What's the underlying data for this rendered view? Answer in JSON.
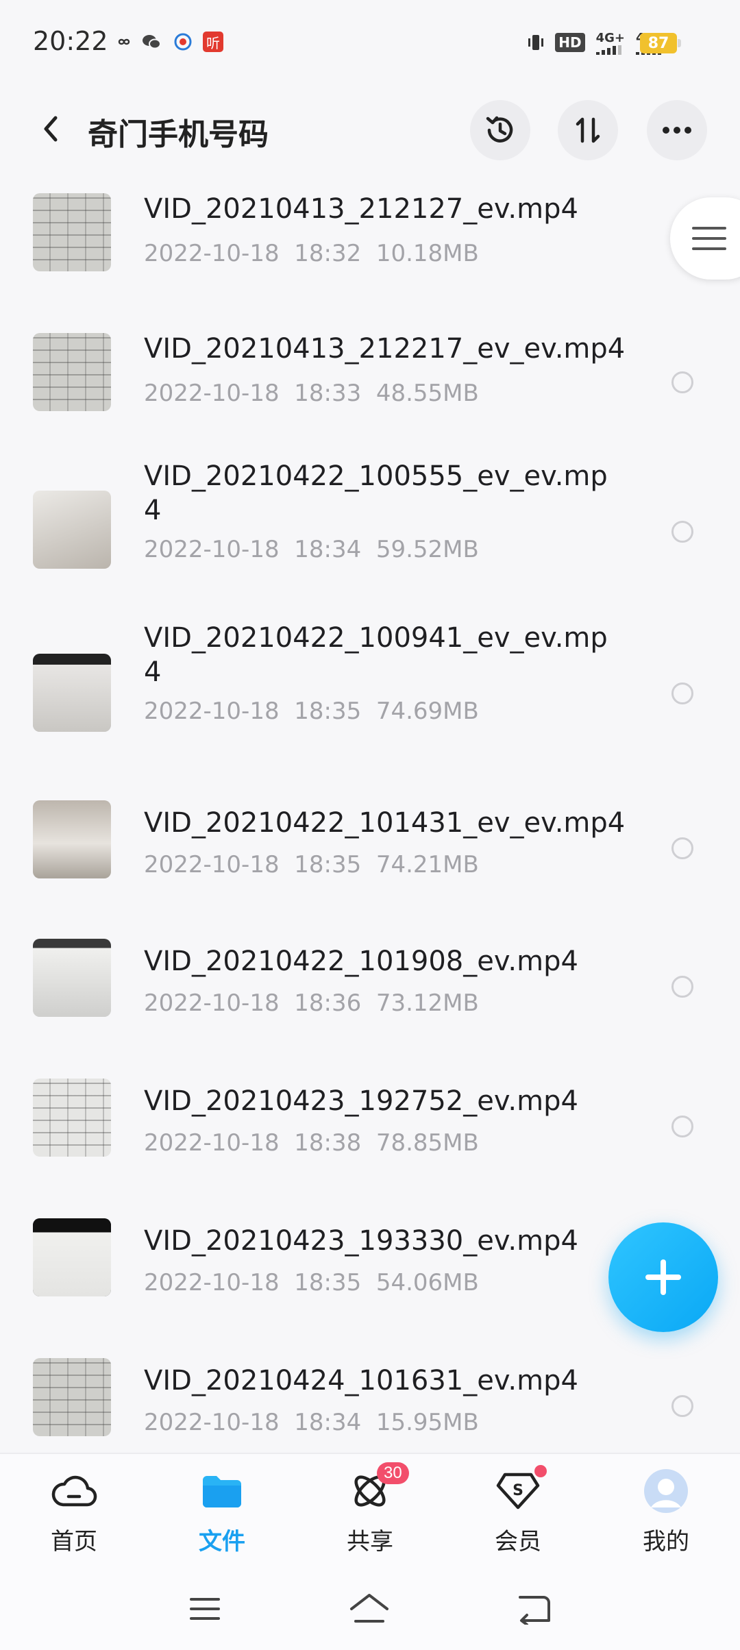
{
  "status_bar": {
    "time": "20:22",
    "apps": [
      "infinity-icon",
      "wechat-icon",
      "app-icon",
      "听"
    ],
    "hd": "HD",
    "sim1_net": "4G+",
    "sim2_net": "4G",
    "battery": "87"
  },
  "header": {
    "title": "奇门手机号码",
    "back_icon": "chevron-left-icon",
    "history_icon": "history-icon",
    "sort_icon": "sort-icon",
    "more_icon": "more-icon"
  },
  "files": [
    {
      "name": "VID_20210413_212127_ev.mp4",
      "date": "2022-10-18",
      "time": "18:32",
      "size": "10.18MB"
    },
    {
      "name": "VID_20210413_212217_ev_ev.mp4",
      "date": "2022-10-18",
      "time": "18:33",
      "size": "48.55MB"
    },
    {
      "name": "VID_20210422_100555_ev_ev.mp4",
      "date": "2022-10-18",
      "time": "18:34",
      "size": "59.52MB"
    },
    {
      "name": "VID_20210422_100941_ev_ev.mp4",
      "date": "2022-10-18",
      "time": "18:35",
      "size": "74.69MB"
    },
    {
      "name": "VID_20210422_101431_ev_ev.mp4",
      "date": "2022-10-18",
      "time": "18:35",
      "size": "74.21MB"
    },
    {
      "name": "VID_20210422_101908_ev.mp4",
      "date": "2022-10-18",
      "time": "18:36",
      "size": "73.12MB"
    },
    {
      "name": "VID_20210423_192752_ev.mp4",
      "date": "2022-10-18",
      "time": "18:38",
      "size": "78.85MB"
    },
    {
      "name": "VID_20210423_193330_ev.mp4",
      "date": "2022-10-18",
      "time": "18:35",
      "size": "54.06MB"
    },
    {
      "name": "VID_20210424_101631_ev.mp4",
      "date": "2022-10-18",
      "time": "18:34",
      "size": "15.95MB"
    }
  ],
  "fab_icon": "plus-icon",
  "side_handle_icon": "list-menu-icon",
  "bottom_nav": [
    {
      "label": "首页",
      "icon": "cloud-icon"
    },
    {
      "label": "文件",
      "icon": "folder-icon",
      "active": true
    },
    {
      "label": "共享",
      "icon": "share-orbit-icon",
      "badge": "30"
    },
    {
      "label": "会员",
      "icon": "vip-diamond-icon",
      "dot": true
    },
    {
      "label": "我的",
      "icon": "avatar-icon"
    }
  ],
  "colors": {
    "accent": "#1aa0f0",
    "badge": "#f24e6b",
    "battery": "#f1c12d",
    "meta_text": "#a3a3a8"
  }
}
